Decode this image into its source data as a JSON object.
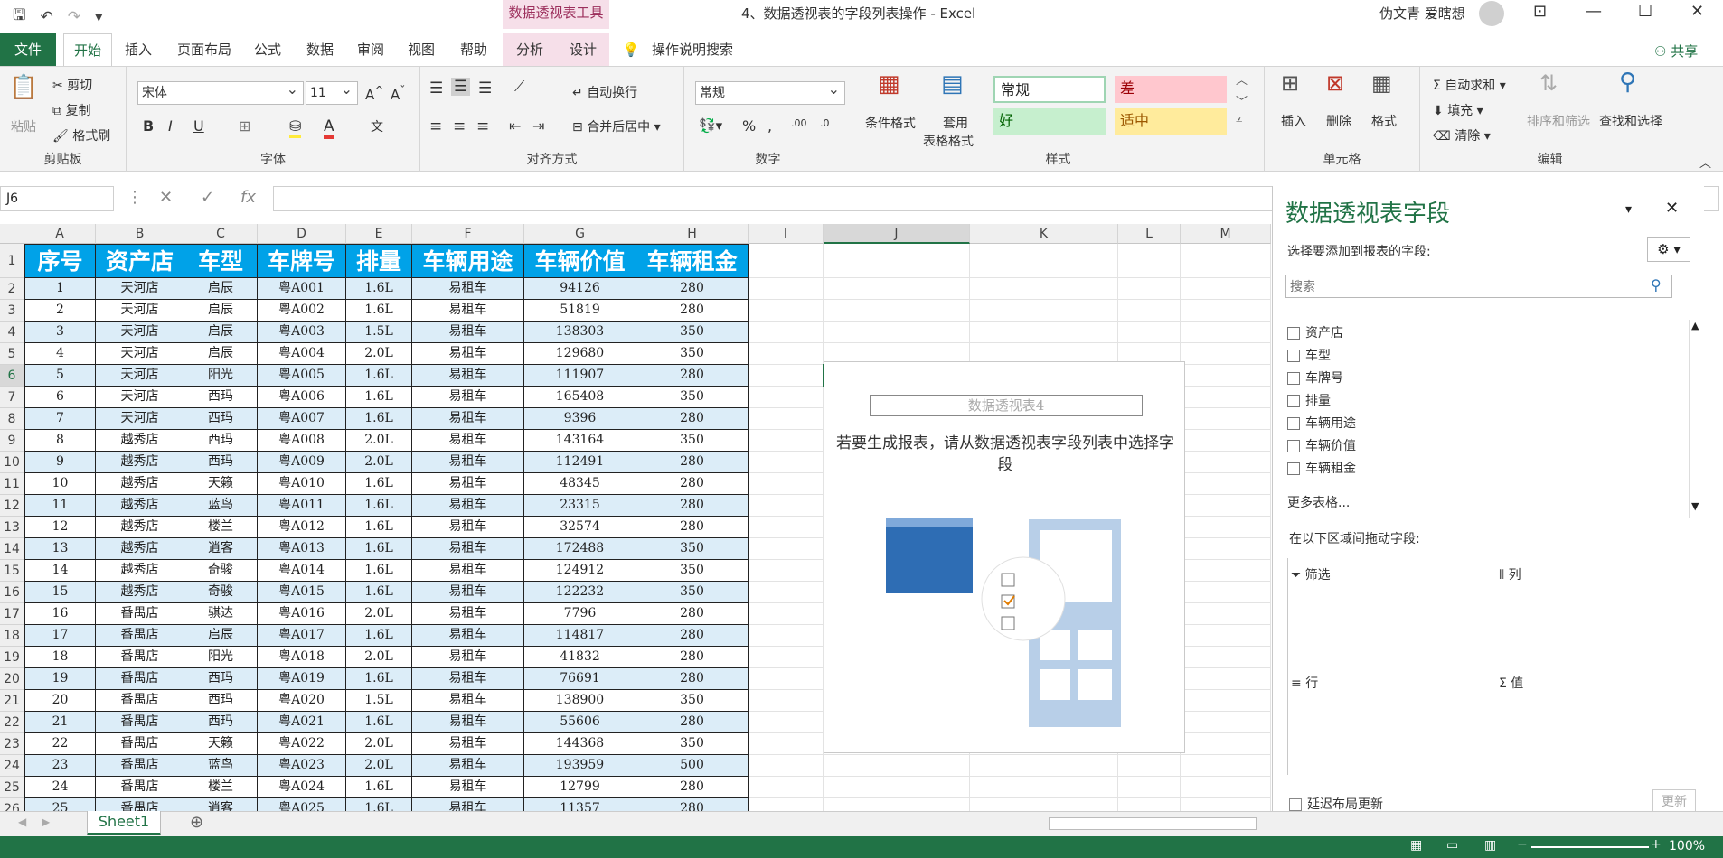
{
  "window": {
    "title": "4、数据透视表的字段列表操作 - Excel",
    "context_tool": "数据透视表工具",
    "user": "伪文青 爱瞎想"
  },
  "tabs": [
    "文件",
    "开始",
    "插入",
    "页面布局",
    "公式",
    "数据",
    "审阅",
    "视图",
    "帮助",
    "分析",
    "设计",
    "操作说明搜索"
  ],
  "share": "共享",
  "ribbon": {
    "clipboard": {
      "paste": "粘贴",
      "cut": "剪切",
      "copy": "复制",
      "painter": "格式刷",
      "label": "剪贴板"
    },
    "font": {
      "name": "宋体",
      "size": "11",
      "label": "字体"
    },
    "align": {
      "wrap": "自动换行",
      "merge": "合并后居中",
      "label": "对齐方式"
    },
    "number": {
      "format": "常规",
      "label": "数字"
    },
    "styles": {
      "cond": "条件格式",
      "table1": "套用",
      "table2": "表格格式",
      "normal": "常规",
      "bad": "差",
      "good": "好",
      "neutral": "适中",
      "label": "样式"
    },
    "cells": {
      "insert": "插入",
      "delete": "删除",
      "format": "格式",
      "label": "单元格"
    },
    "editing": {
      "autosum": "自动求和",
      "fill": "填充",
      "clear": "清除",
      "sort": "排序和筛选",
      "find": "查找和选择",
      "label": "编辑"
    }
  },
  "namebox": "J6",
  "columns": [
    "A",
    "B",
    "C",
    "D",
    "E",
    "F",
    "G",
    "H",
    "I",
    "J",
    "K",
    "L",
    "M"
  ],
  "headers": [
    "序号",
    "资产店",
    "车型",
    "车牌号",
    "排量",
    "车辆用途",
    "车辆价值",
    "车辆租金"
  ],
  "rows": [
    [
      "1",
      "天河店",
      "启辰",
      "粤A001",
      "1.6L",
      "易租车",
      "94126",
      "280"
    ],
    [
      "2",
      "天河店",
      "启辰",
      "粤A002",
      "1.6L",
      "易租车",
      "51819",
      "280"
    ],
    [
      "3",
      "天河店",
      "启辰",
      "粤A003",
      "1.5L",
      "易租车",
      "138303",
      "350"
    ],
    [
      "4",
      "天河店",
      "启辰",
      "粤A004",
      "2.0L",
      "易租车",
      "129680",
      "350"
    ],
    [
      "5",
      "天河店",
      "阳光",
      "粤A005",
      "1.6L",
      "易租车",
      "111907",
      "280"
    ],
    [
      "6",
      "天河店",
      "西玛",
      "粤A006",
      "1.6L",
      "易租车",
      "165408",
      "350"
    ],
    [
      "7",
      "天河店",
      "西玛",
      "粤A007",
      "1.6L",
      "易租车",
      "9396",
      "280"
    ],
    [
      "8",
      "越秀店",
      "西玛",
      "粤A008",
      "2.0L",
      "易租车",
      "143164",
      "350"
    ],
    [
      "9",
      "越秀店",
      "西玛",
      "粤A009",
      "2.0L",
      "易租车",
      "112491",
      "280"
    ],
    [
      "10",
      "越秀店",
      "天籁",
      "粤A010",
      "1.6L",
      "易租车",
      "48345",
      "280"
    ],
    [
      "11",
      "越秀店",
      "蓝鸟",
      "粤A011",
      "1.6L",
      "易租车",
      "23315",
      "280"
    ],
    [
      "12",
      "越秀店",
      "楼兰",
      "粤A012",
      "1.6L",
      "易租车",
      "32574",
      "280"
    ],
    [
      "13",
      "越秀店",
      "逍客",
      "粤A013",
      "1.6L",
      "易租车",
      "172488",
      "350"
    ],
    [
      "14",
      "越秀店",
      "奇骏",
      "粤A014",
      "1.6L",
      "易租车",
      "124912",
      "350"
    ],
    [
      "15",
      "越秀店",
      "奇骏",
      "粤A015",
      "1.6L",
      "易租车",
      "122232",
      "350"
    ],
    [
      "16",
      "番禺店",
      "骐达",
      "粤A016",
      "2.0L",
      "易租车",
      "7796",
      "280"
    ],
    [
      "17",
      "番禺店",
      "启辰",
      "粤A017",
      "1.6L",
      "易租车",
      "114817",
      "280"
    ],
    [
      "18",
      "番禺店",
      "阳光",
      "粤A018",
      "2.0L",
      "易租车",
      "41832",
      "280"
    ],
    [
      "19",
      "番禺店",
      "西玛",
      "粤A019",
      "1.6L",
      "易租车",
      "76691",
      "280"
    ],
    [
      "20",
      "番禺店",
      "西玛",
      "粤A020",
      "1.5L",
      "易租车",
      "138900",
      "350"
    ],
    [
      "21",
      "番禺店",
      "西玛",
      "粤A021",
      "1.6L",
      "易租车",
      "55606",
      "280"
    ],
    [
      "22",
      "番禺店",
      "天籁",
      "粤A022",
      "2.0L",
      "易租车",
      "144368",
      "350"
    ],
    [
      "23",
      "番禺店",
      "蓝鸟",
      "粤A023",
      "2.0L",
      "易租车",
      "193959",
      "500"
    ],
    [
      "24",
      "番禺店",
      "楼兰",
      "粤A024",
      "1.6L",
      "易租车",
      "12799",
      "280"
    ],
    [
      "25",
      "番禺店",
      "逍客",
      "粤A025",
      "1.6L",
      "易租车",
      "11357",
      "280"
    ]
  ],
  "pivot": {
    "name": "数据透视表4",
    "message": "若要生成报表，请从数据透视表字段列表中选择字段"
  },
  "pane": {
    "title": "数据透视表字段",
    "subtitle": "选择要添加到报表的字段:",
    "search_placeholder": "搜索",
    "fields": [
      "资产店",
      "车型",
      "车牌号",
      "排量",
      "车辆用途",
      "车辆价值",
      "车辆租金"
    ],
    "more": "更多表格...",
    "drag_hint": "在以下区域间拖动字段:",
    "areas": {
      "filter": "筛选",
      "columns": "列",
      "rows": "行",
      "values": "值"
    },
    "defer": "延迟布局更新",
    "update": "更新"
  },
  "sheet": "Sheet1",
  "zoom": "100%"
}
